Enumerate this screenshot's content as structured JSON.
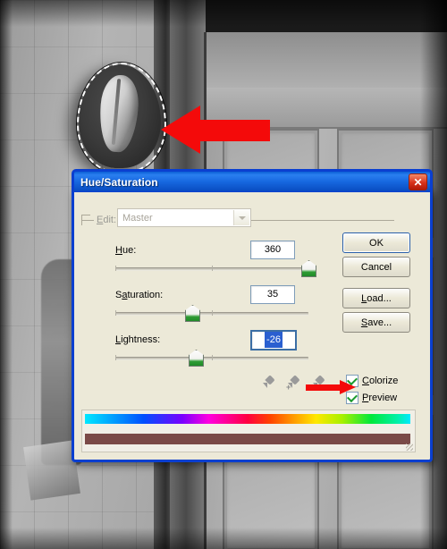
{
  "app": {
    "photo_alt": "grayscale-photo-cowboy-hat-on-wall-beside-door",
    "selection_label": "marching-ants-selection"
  },
  "dialog": {
    "title": "Hue/Saturation",
    "close_label": "✕",
    "edit": {
      "label": "Edit:",
      "label_underline_index": 0,
      "value": "Master",
      "disabled": true
    },
    "controls": [
      {
        "name": "hue",
        "label": "Hue:",
        "label_html": "<u>H</u>ue:",
        "value": "360",
        "slider_percent": 100,
        "selected": false
      },
      {
        "name": "saturation",
        "label": "Saturation:",
        "label_html": "S<u>a</u>turation:",
        "value": "35",
        "slider_percent": 36,
        "selected": false
      },
      {
        "name": "lightness",
        "label": "Lightness:",
        "label_html": "<u>L</u>ightness:",
        "value": "-26",
        "slider_percent": 43,
        "selected": true
      }
    ],
    "buttons": [
      {
        "name": "ok",
        "label": "OK",
        "label_html": "OK",
        "default": true
      },
      {
        "name": "cancel",
        "label": "Cancel",
        "label_html": "Cancel",
        "default": false
      },
      {
        "name": "load",
        "label": "Load...",
        "label_html": "<u>L</u>oad...",
        "default": false
      },
      {
        "name": "save",
        "label": "Save...",
        "label_html": "<u>S</u>ave...",
        "default": false
      }
    ],
    "checkboxes": [
      {
        "name": "colorize",
        "label": "Colorize",
        "label_html": "<u>C</u>olorize",
        "checked": true
      },
      {
        "name": "preview",
        "label": "Preview",
        "label_html": "<u>P</u>review",
        "checked": true
      }
    ],
    "eyedroppers": [
      {
        "name": "eyedropper",
        "modifier": ""
      },
      {
        "name": "eyedropper-add",
        "modifier": "+"
      },
      {
        "name": "eyedropper-subtract",
        "modifier": "-"
      }
    ],
    "color_bars": {
      "spectrum_name": "hue-spectrum-bar",
      "result_name": "result-color-bar",
      "result_color": "#7a4a47"
    }
  },
  "annotations": {
    "arrow_to_hat": "red-arrow-pointing-left-at-hat",
    "arrow_to_colorize": "red-arrow-pointing-right-at-colorize"
  },
  "colors": {
    "titlebar_blue": "#0a4fc4",
    "dialog_face": "#ece9d8",
    "arrow_red": "#f40a0a",
    "slider_green": "#2f9c34",
    "selection_blue": "#2a5fd0"
  }
}
